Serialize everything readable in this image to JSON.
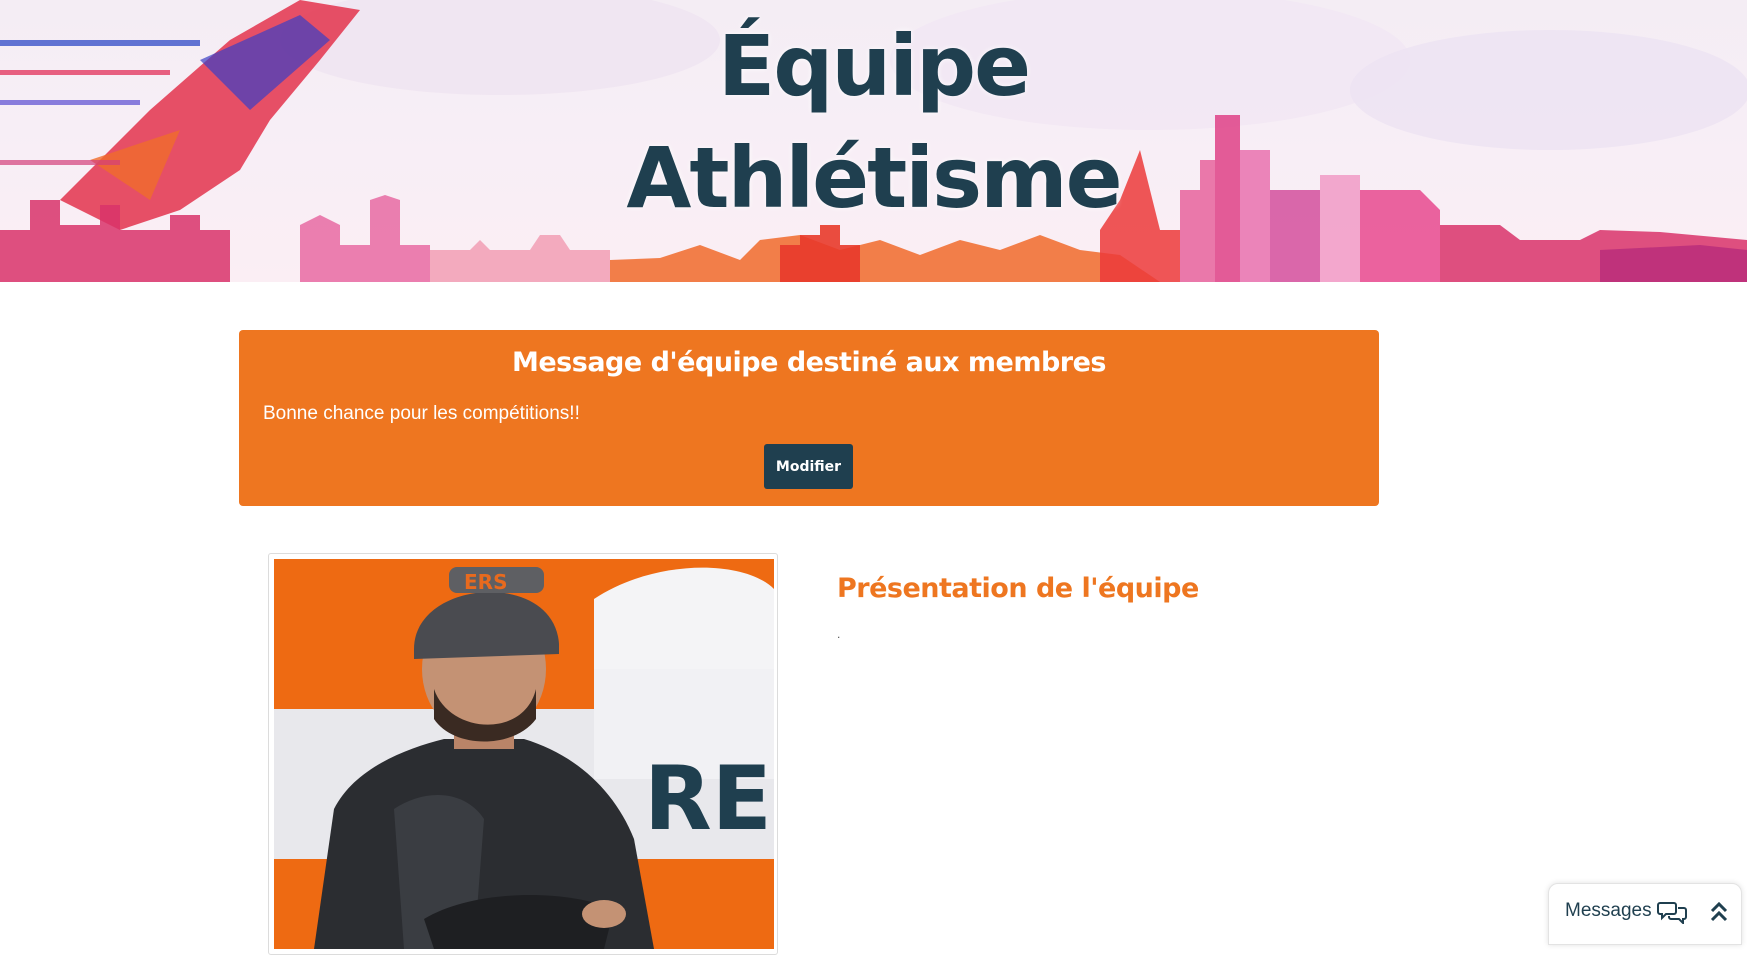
{
  "banner": {
    "title_line1": "Équipe",
    "title_line2": "Athlétisme"
  },
  "team_message": {
    "heading": "Message d'équipe destiné aux membres",
    "text": "Bonne chance pour les compétitions!!",
    "modify_button": "Modifier"
  },
  "presentation": {
    "title": "Présentation de l'équipe",
    "text": "."
  },
  "messages_widget": {
    "label": "Messages",
    "chat_icon": "chat-bubbles-icon",
    "collapse_icon": "double-chevron-up-icon"
  },
  "colors": {
    "primary_orange": "#ee7620",
    "dark_teal": "#1f3f4f"
  }
}
